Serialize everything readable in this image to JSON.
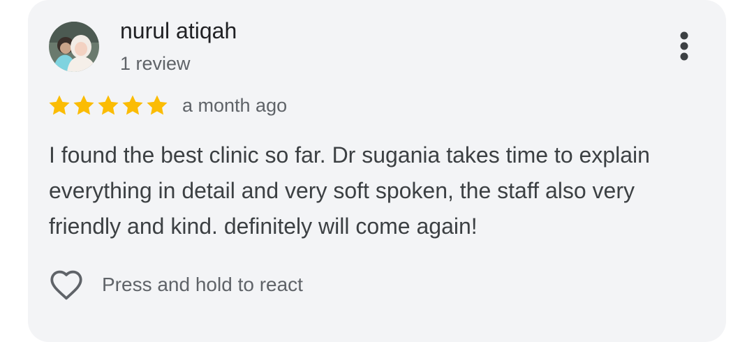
{
  "review": {
    "author_name": "nurul atiqah",
    "author_reviews": "1 review",
    "avatar_icon": "user-photo-avatar",
    "rating": 5,
    "rating_max": 5,
    "date": "a month ago",
    "text": "I found the best clinic so far. Dr sugania takes time to explain everything in detail and very soft spoken, the staff also very friendly and kind. definitely will come again!",
    "react_label": "Press and hold to react",
    "react_icon": "heart-outline-icon",
    "menu_icon": "more-vert-icon"
  },
  "colors": {
    "card_background": "#f3f4f6",
    "star": "#fbbc04",
    "primary_text": "#202124",
    "secondary_text": "#5f6368",
    "body_text": "#3c4043"
  }
}
